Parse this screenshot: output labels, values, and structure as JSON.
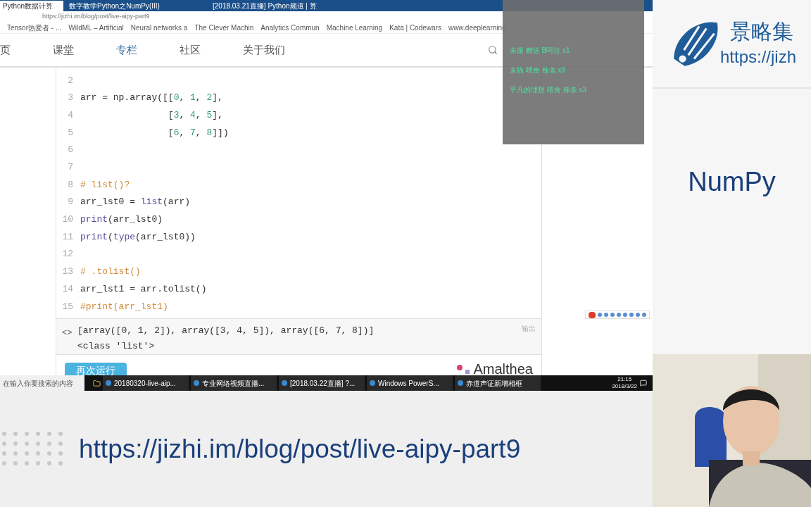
{
  "browser": {
    "tabs": [
      {
        "label": "Python数据计算",
        "selected": true
      },
      {
        "label": "数字教学Python之NumPy(III)",
        "selected": false
      },
      {
        "label": "[2018.03.21直播] Python频道 | 算",
        "selected": false
      }
    ],
    "address": "https://jizhi.im/blog/post/live-aipy-part9",
    "bookmarks": [
      "Tensor热爱者 - ...",
      "WildML – Artificial",
      "Neural networks a",
      "The Clever Machin",
      "Analytics Commun",
      "Machine Learning",
      "Kata | Codewars",
      "www.deeplearning."
    ]
  },
  "site_nav": {
    "items": [
      {
        "label": "页",
        "selected": false
      },
      {
        "label": "课堂",
        "selected": false
      },
      {
        "label": "专栏",
        "selected": true
      },
      {
        "label": "社区",
        "selected": false
      },
      {
        "label": "关于我们",
        "selected": false
      }
    ]
  },
  "editor": {
    "lines": [
      {
        "number": "2"
      },
      {
        "number": "3",
        "tokens": [
          {
            "text": "arr = np.array([[",
            "kind": "plain"
          },
          {
            "text": "0",
            "kind": "num"
          },
          {
            "text": ", ",
            "kind": "plain"
          },
          {
            "text": "1",
            "kind": "num"
          },
          {
            "text": ", ",
            "kind": "plain"
          },
          {
            "text": "2",
            "kind": "num"
          },
          {
            "text": "],",
            "kind": "plain"
          }
        ]
      },
      {
        "number": "4",
        "tokens": [
          {
            "text": "                [",
            "kind": "plain"
          },
          {
            "text": "3",
            "kind": "num"
          },
          {
            "text": ", ",
            "kind": "plain"
          },
          {
            "text": "4",
            "kind": "num"
          },
          {
            "text": ", ",
            "kind": "plain"
          },
          {
            "text": "5",
            "kind": "num"
          },
          {
            "text": "],",
            "kind": "plain"
          }
        ]
      },
      {
        "number": "5",
        "tokens": [
          {
            "text": "                [",
            "kind": "plain"
          },
          {
            "text": "6",
            "kind": "num"
          },
          {
            "text": ", ",
            "kind": "plain"
          },
          {
            "text": "7",
            "kind": "num"
          },
          {
            "text": ", ",
            "kind": "plain"
          },
          {
            "text": "8",
            "kind": "num"
          },
          {
            "text": "]])",
            "kind": "plain"
          }
        ]
      },
      {
        "number": "6"
      },
      {
        "number": "7"
      },
      {
        "number": "8",
        "tokens": [
          {
            "text": "# list()?",
            "kind": "comment"
          }
        ]
      },
      {
        "number": "9",
        "tokens": [
          {
            "text": "arr_lst0 = ",
            "kind": "plain"
          },
          {
            "text": "list",
            "kind": "builtin"
          },
          {
            "text": "(arr)",
            "kind": "plain"
          }
        ]
      },
      {
        "number": "10",
        "tokens": [
          {
            "text": "print",
            "kind": "builtin"
          },
          {
            "text": "(arr_lst0)",
            "kind": "plain"
          }
        ]
      },
      {
        "number": "11",
        "tokens": [
          {
            "text": "print",
            "kind": "builtin"
          },
          {
            "text": "(",
            "kind": "plain"
          },
          {
            "text": "type",
            "kind": "builtin"
          },
          {
            "text": "(arr_lst0))",
            "kind": "plain"
          }
        ]
      },
      {
        "number": "12"
      },
      {
        "number": "13",
        "tokens": [
          {
            "text": "# .tolist()",
            "kind": "comment"
          }
        ]
      },
      {
        "number": "14",
        "tokens": [
          {
            "text": "arr_lst1 = arr.tolist()",
            "kind": "plain"
          }
        ]
      },
      {
        "number": "15",
        "tokens": [
          {
            "text": "#print(arr_lst1)",
            "kind": "comment"
          }
        ]
      }
    ],
    "output": {
      "prompt": "<>",
      "lines": [
        "[array([0, 1, 2]), array([3, 4, 5]), array([6, 7, 8])]",
        "<class 'list'>"
      ],
      "label": "输出"
    },
    "run_button": "再次运行",
    "brand": "Amalthea"
  },
  "gift_overlay": {
    "messages": [
      "未服 赠送 B呵拉 x1",
      "末猫 喂食 辣条 x3",
      "平凡的理想 喂食 辣条 x3"
    ]
  },
  "taskbar": {
    "search_placeholder": "在输入你要搜索的内容",
    "apps": [
      "20180320-live-aip...",
      "专业网络视频直播...",
      "[2018.03.22直播] ?...",
      "Windows PowerS...",
      "赤道声证新增相框"
    ],
    "time": "21:15",
    "date": "2018/3/22"
  },
  "slide": {
    "brand": "景略集",
    "url": "https://jizh",
    "title": "NumPy"
  },
  "banner": {
    "url": "https://jizhi.im/blog/post/live-aipy-part9"
  }
}
